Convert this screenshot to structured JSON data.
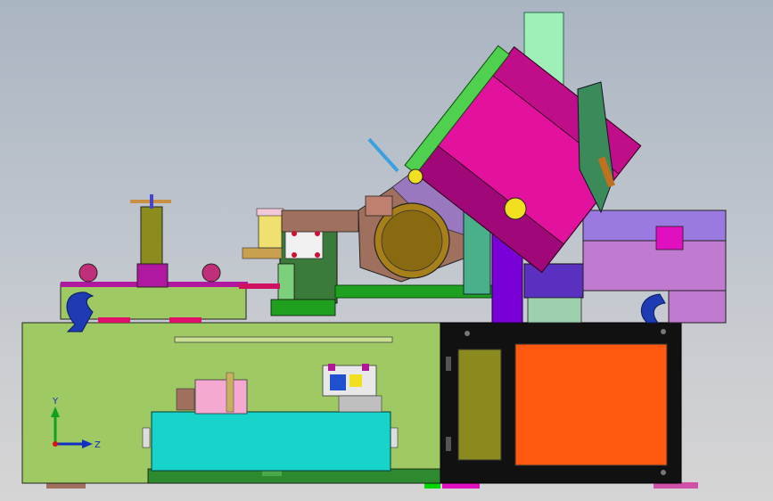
{
  "viewport": {
    "background_top": "#aab5c2",
    "background_bottom": "#d6d5d5"
  },
  "triad": {
    "y_label": "Y",
    "z_label": "Z",
    "y_color": "#10a020",
    "z_color": "#1030c0"
  },
  "colors": {
    "base_frame": "#9fca63",
    "cabinet": "#111111",
    "cabinet_panel": "#ff5a0f",
    "cabinet_door": "#8a8a1e",
    "tank": "#16d4c9",
    "saw_guard": "#e2129e",
    "green_rail": "#1fa01f",
    "motor": "#a8801a",
    "table_lilac": "#c07ad0",
    "column": "#9ef0b8",
    "purple": "#7a00d8",
    "hook": "#1f3bb3"
  }
}
